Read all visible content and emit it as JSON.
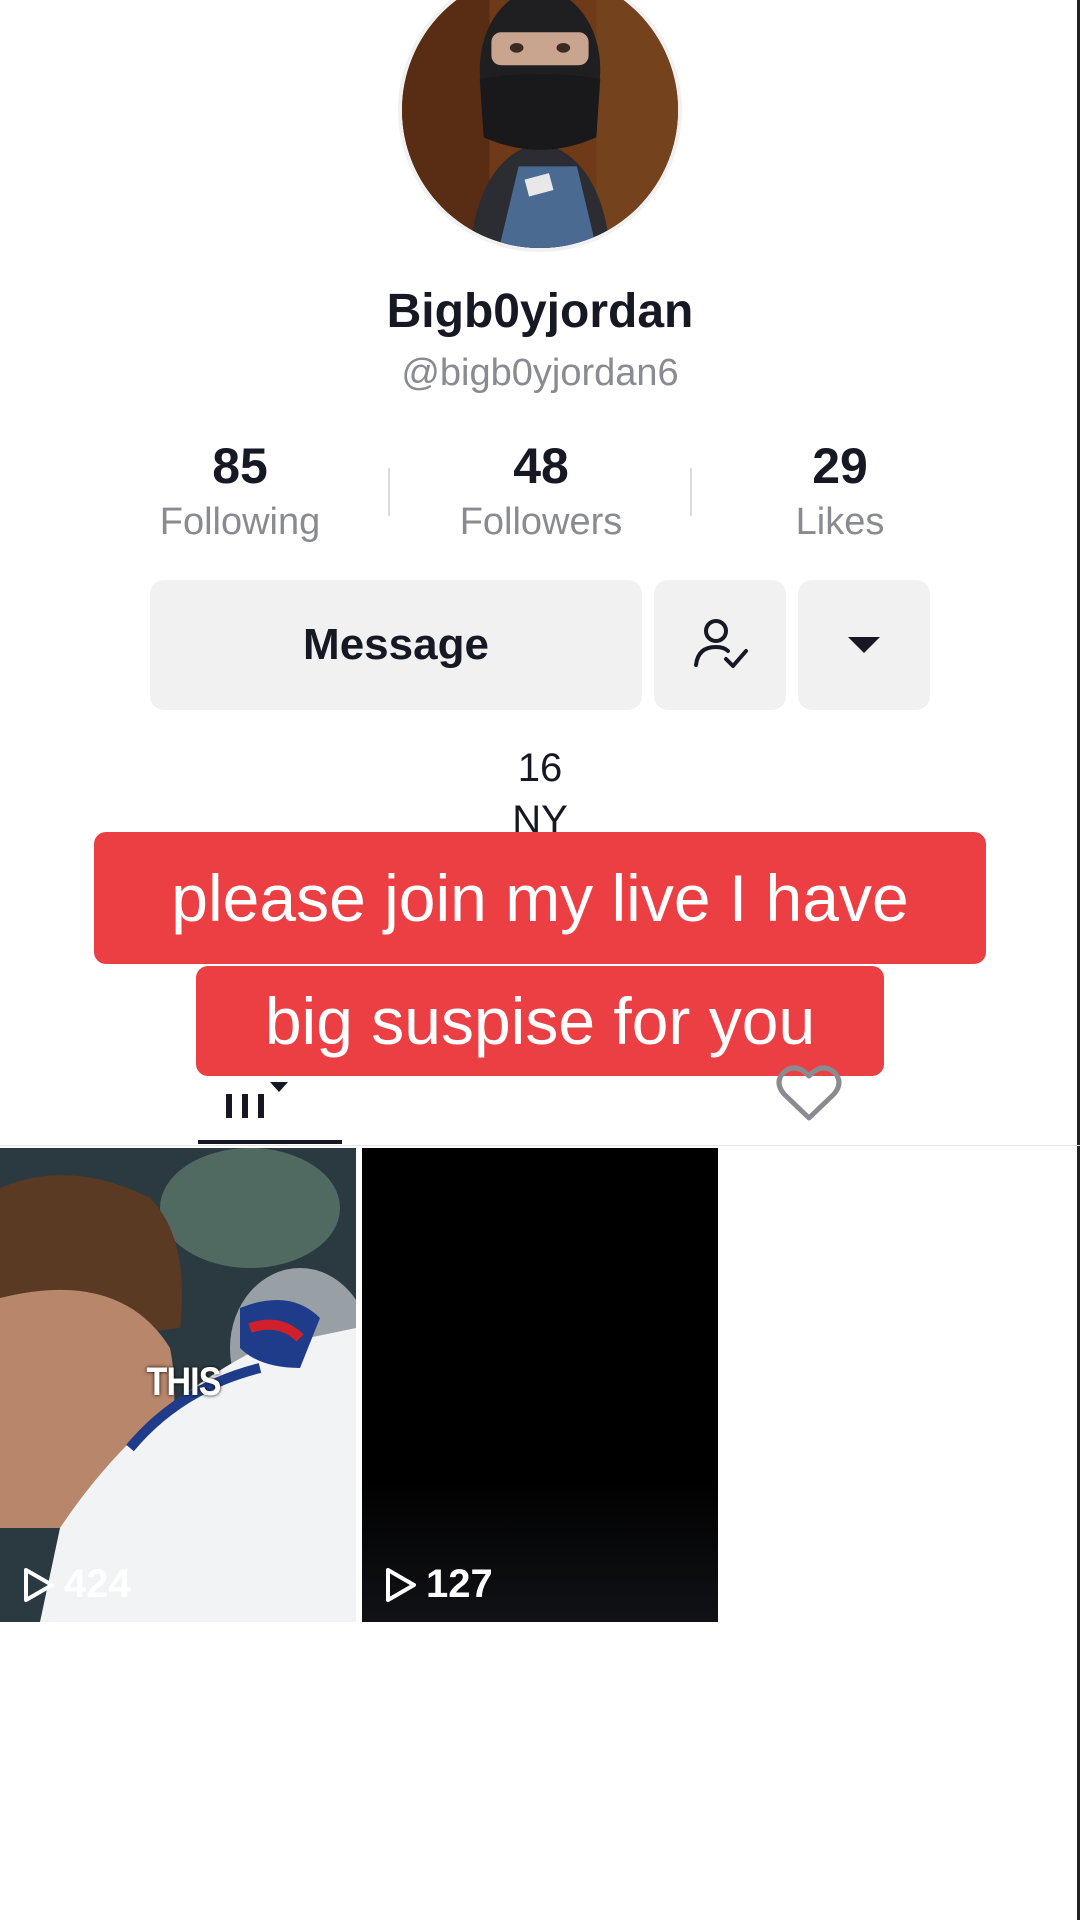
{
  "profile": {
    "display_name": "Bigb0yjordan",
    "handle": "@bigb0yjordan6"
  },
  "stats": {
    "following": {
      "count": "85",
      "label": "Following"
    },
    "followers": {
      "count": "48",
      "label": "Followers"
    },
    "likes": {
      "count": "29",
      "label": "Likes"
    }
  },
  "actions": {
    "message_label": "Message",
    "follow_icon": "person-check-icon",
    "more_icon": "caret-down-icon"
  },
  "bio": {
    "age": "16",
    "location": "NY"
  },
  "overlay": {
    "line1": "please join my live I have",
    "line2": "big suspise for you"
  },
  "tabs": {
    "videos_icon": "grid-icon",
    "liked_icon": "heart-icon"
  },
  "videos": [
    {
      "views": "424",
      "caption_word": "THIS"
    },
    {
      "views": "127"
    }
  ],
  "colors": {
    "overlay_red": "#eb3f44",
    "button_gray": "#f1f1f2",
    "secondary_text": "#8a8b91"
  }
}
